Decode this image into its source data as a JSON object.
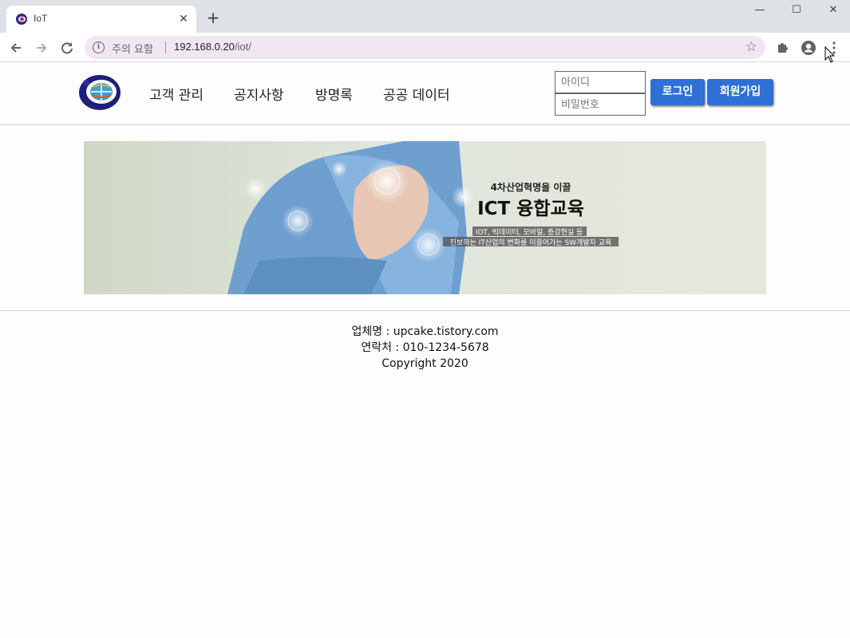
{
  "browser": {
    "tab_title": "IoT",
    "tab_close": "✕",
    "new_tab": "+",
    "window_controls": {
      "minimize": "—",
      "maximize": "☐",
      "close": "✕"
    },
    "address_warning": "주의 요함",
    "url_host": "192.168.0.20",
    "url_path": "/iot/",
    "icons": [
      "back-icon",
      "forward-icon",
      "reload-icon",
      "info-icon",
      "star-icon",
      "extensions-icon",
      "profile-icon",
      "menu-icon"
    ]
  },
  "header": {
    "menu": [
      "고객 관리",
      "공지사항",
      "방명록",
      "공공 데이터"
    ],
    "login": {
      "id_placeholder": "아이디",
      "pw_placeholder": "비밀번호",
      "login_label": "로그인",
      "signup_label": "회원가입"
    }
  },
  "banner": {
    "kicker": "4차산업혁명을 이끌",
    "title": "ICT 융합교육",
    "line1": "IOT, 빅데이터, 모바일, 증강현실 등",
    "line2": "진보하는 IT산업의 변화를 이끌어가는 SW개발자 교육"
  },
  "footer": {
    "company": "업체명 : upcake.tistory.com",
    "contact": "연락처 : 010-1234-5678",
    "copyright": "Copyright 2020"
  },
  "colors": {
    "button": "#2f6fd6",
    "omnibox": "#f1e6f2",
    "tabstrip": "#dee1e6"
  }
}
